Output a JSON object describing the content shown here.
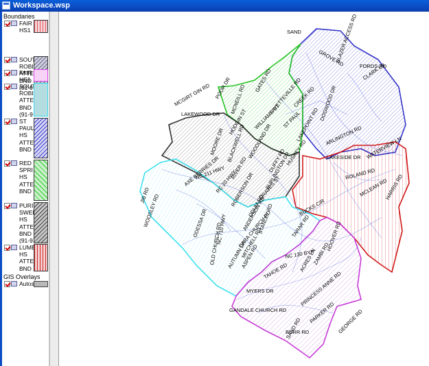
{
  "window": {
    "title": "Workspace.wsp"
  },
  "sidebar": {
    "boundaries_label": "Boundaries",
    "layers": [
      {
        "lines": [
          "FAIR",
          "HS1"
        ],
        "swatch_color": "#e8505a",
        "swatch_bg": "#f3d6d8",
        "pattern": "vertical"
      },
      {
        "lines": [
          "SOUT",
          "ROBI",
          "ATTE",
          "BND",
          "(91-9"
        ],
        "swatch_color": "#6a6a8a",
        "swatch_bg": "#cfcfdf",
        "pattern": "diagonal"
      },
      {
        "lines": [
          "FAIR",
          "HS1"
        ],
        "swatch_color": "#e040e8",
        "swatch_bg": "#f7d4f7",
        "pattern": "solid"
      },
      {
        "lines": [
          "SOUT",
          "ROBI",
          "ATTE",
          "BND",
          "(91-9"
        ],
        "swatch_color": "#38d8e8",
        "swatch_bg": "#b4dde1",
        "pattern": "solid"
      },
      {
        "lines": [
          "ST",
          "PAUL",
          "HS",
          "ATTE",
          "BND"
        ],
        "swatch_color": "#3a3ad0",
        "swatch_bg": "#d7d7f4",
        "pattern": "diagonal"
      },
      {
        "lines": [
          "RED",
          "SPRI",
          "HS",
          "ATTE",
          "BND"
        ],
        "swatch_color": "#30c830",
        "swatch_bg": "#c8f0c8",
        "pattern": "diagonal-light"
      },
      {
        "lines": [
          "PURI",
          "SWEI",
          "HS",
          "ATTE",
          "BND",
          "(91-9"
        ],
        "swatch_color": "#404040",
        "swatch_bg": "#c8c8c8",
        "pattern": "diagonal"
      },
      {
        "lines": [
          "LUMB",
          "HS",
          "ATTE",
          "BND"
        ],
        "swatch_color": "#d02020",
        "swatch_bg": "#f4d0d0",
        "pattern": "vertical"
      }
    ],
    "overlays_label": "GIS Overlays",
    "overlay_item": {
      "label": "Autos",
      "swatch_color": "#b8b8b8"
    }
  },
  "map": {
    "district_colors": {
      "blue": "#3434c8",
      "green": "#22c322",
      "dark": "#303030",
      "cyan": "#3ee0ee",
      "red": "#d01818",
      "magenta": "#c73ad6"
    },
    "road_labels": [
      "SAND",
      "GROVE RD",
      "BLAZER ACCESS RD",
      "FORDS RD",
      "CLARK LN",
      "MCGIRT GIN RD",
      "POOR DR",
      "MCNEILL RD",
      "GATES RD",
      "LAKEWOOD DR",
      "FAYETTEVILLE RD",
      "CREEK RD",
      "WILLIAMS ST",
      "ST PAUL",
      "ARLINGTON RD",
      "LAKEPOINT RD",
      "LAKESIDE DR",
      "DOGWOOD DR",
      "WATERVIEW LN",
      "ROLAND RD",
      "MCLEAN RD",
      "HARRIS RD",
      "HODGIN ST",
      "MOORE DR",
      "BLACKWELL RD",
      "RIVER RD",
      "WOODLAND DR",
      "DUFFY RD",
      "HUSKEY RD",
      "BURLINGTON DR",
      "NC 211 HWY",
      "RC 20 HWY",
      "GRAVES ST",
      "AXE BERRIES DR",
      "JIB RD",
      "WOOSLEY RD",
      "ODESSA DR",
      "NC 710 HWY",
      "OLD CHURCH RD",
      "ANDERSON RD",
      "ROBERSON DR",
      "ODUM RD",
      "CARA CHURCH RD",
      "MITCHELL RD",
      "ASPEN RD",
      "BUCKS CIR",
      "STANLEY RD",
      "TARAR RD",
      "NC 130 BYP",
      "TAHOE RD",
      "ACRES LN",
      "ZAMBI RD",
      "HOOVER RD",
      "AUTUMN DR",
      "MYERS DR",
      "PRINCESS ANNE RD",
      "GANDALE CHURCH RD",
      "PARKER RD",
      "GEORGE RD",
      "SAND RD",
      "BURR RD"
    ]
  }
}
